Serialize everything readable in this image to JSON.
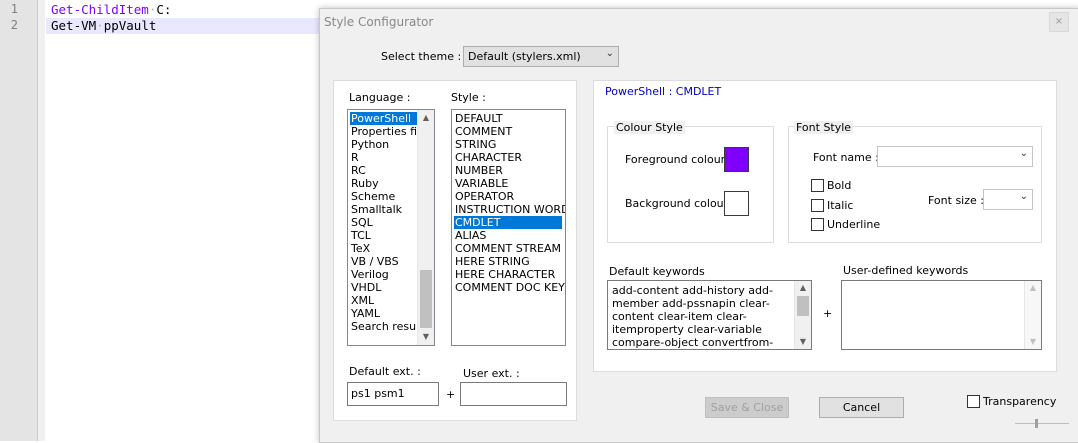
{
  "editor": {
    "lines": [
      {
        "number": "1",
        "cmd": "Get-ChildItem",
        "arg": "C:"
      },
      {
        "number": "2",
        "cmd": "Get-VM",
        "arg": "ppVault"
      }
    ]
  },
  "dialog": {
    "title": "Style Configurator",
    "close_glyph": "×",
    "select_theme_label": "Select theme :",
    "theme_value": "Default (stylers.xml)",
    "language_label": "Language :",
    "languages": [
      "PowerShell",
      "Properties file",
      "Python",
      "R",
      "RC",
      "Ruby",
      "Scheme",
      "Smalltalk",
      "SQL",
      "TCL",
      "TeX",
      "VB / VBS",
      "Verilog",
      "VHDL",
      "XML",
      "YAML",
      "Search result"
    ],
    "selected_language": "PowerShell",
    "style_label": "Style :",
    "styles": [
      "DEFAULT",
      "COMMENT",
      "STRING",
      "CHARACTER",
      "NUMBER",
      "VARIABLE",
      "OPERATOR",
      "INSTRUCTION WORD",
      "CMDLET",
      "ALIAS",
      "COMMENT STREAM",
      "HERE STRING",
      "HERE CHARACTER",
      "COMMENT DOC KEYWORD"
    ],
    "selected_style": "CMDLET",
    "default_ext_label": "Default ext. :",
    "default_ext_value": "ps1 psm1",
    "user_ext_label": "User ext. :",
    "user_ext_value": "",
    "plus": "+",
    "style_heading": "PowerShell : CMDLET",
    "colour_style_label": "Colour Style",
    "foreground_label": "Foreground colour",
    "foreground_color": "#8000ff",
    "background_label": "Background colour",
    "background_color": "#ffffff",
    "font_style_label": "Font Style",
    "font_name_label": "Font name :",
    "font_name_value": "",
    "bold_label": "Bold",
    "italic_label": "Italic",
    "underline_label": "Underline",
    "font_size_label": "Font size :",
    "font_size_value": "",
    "default_keywords_label": "Default keywords",
    "default_keywords_text": "add-content add-history add-member add-pssnapin clear-content clear-item clear-itemproperty clear-variable compare-object convertfrom-securestring convert-",
    "user_keywords_label": "User-defined keywords",
    "user_keywords_value": "",
    "save_close_label": "Save & Close",
    "cancel_label": "Cancel",
    "transparency_label": "Transparency",
    "accent_color": "#0078d7"
  }
}
